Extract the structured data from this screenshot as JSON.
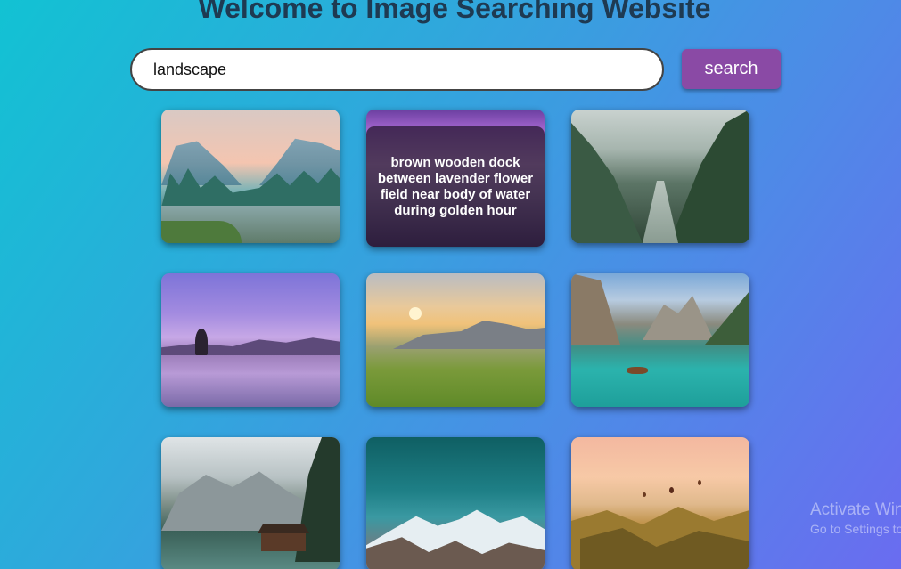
{
  "header": {
    "title": "Welcome to Image Searching Website"
  },
  "search": {
    "value": "landscape",
    "button_label": "search"
  },
  "results": [
    {
      "id": "r1",
      "alt": "mountain valley with forest and river at sunrise"
    },
    {
      "id": "r2",
      "alt": "brown wooden dock between lavender flower field near body of water during golden hour",
      "hover_caption": "brown wooden dock between lavender flower field near body of water during golden hour"
    },
    {
      "id": "r3",
      "alt": "misty forest valley with stream"
    },
    {
      "id": "r4",
      "alt": "lone tree in lake at purple dusk"
    },
    {
      "id": "r5",
      "alt": "grassy meadow with mountains at sunset"
    },
    {
      "id": "r6",
      "alt": "turquoise lake with boat between mountains"
    },
    {
      "id": "r7",
      "alt": "wooden cabin on lake beneath mountains"
    },
    {
      "id": "r8",
      "alt": "snow capped mountains under teal sky"
    },
    {
      "id": "r9",
      "alt": "hot air balloons over valley at sunrise"
    }
  ],
  "watermark": {
    "line1": "Activate Windows",
    "line2": "Go to Settings to activate Windows."
  },
  "colors": {
    "title": "#1e3a52",
    "button_bg": "#8a4aa5",
    "bg_start": "#12c2d3",
    "bg_end": "#6a6cf0"
  }
}
